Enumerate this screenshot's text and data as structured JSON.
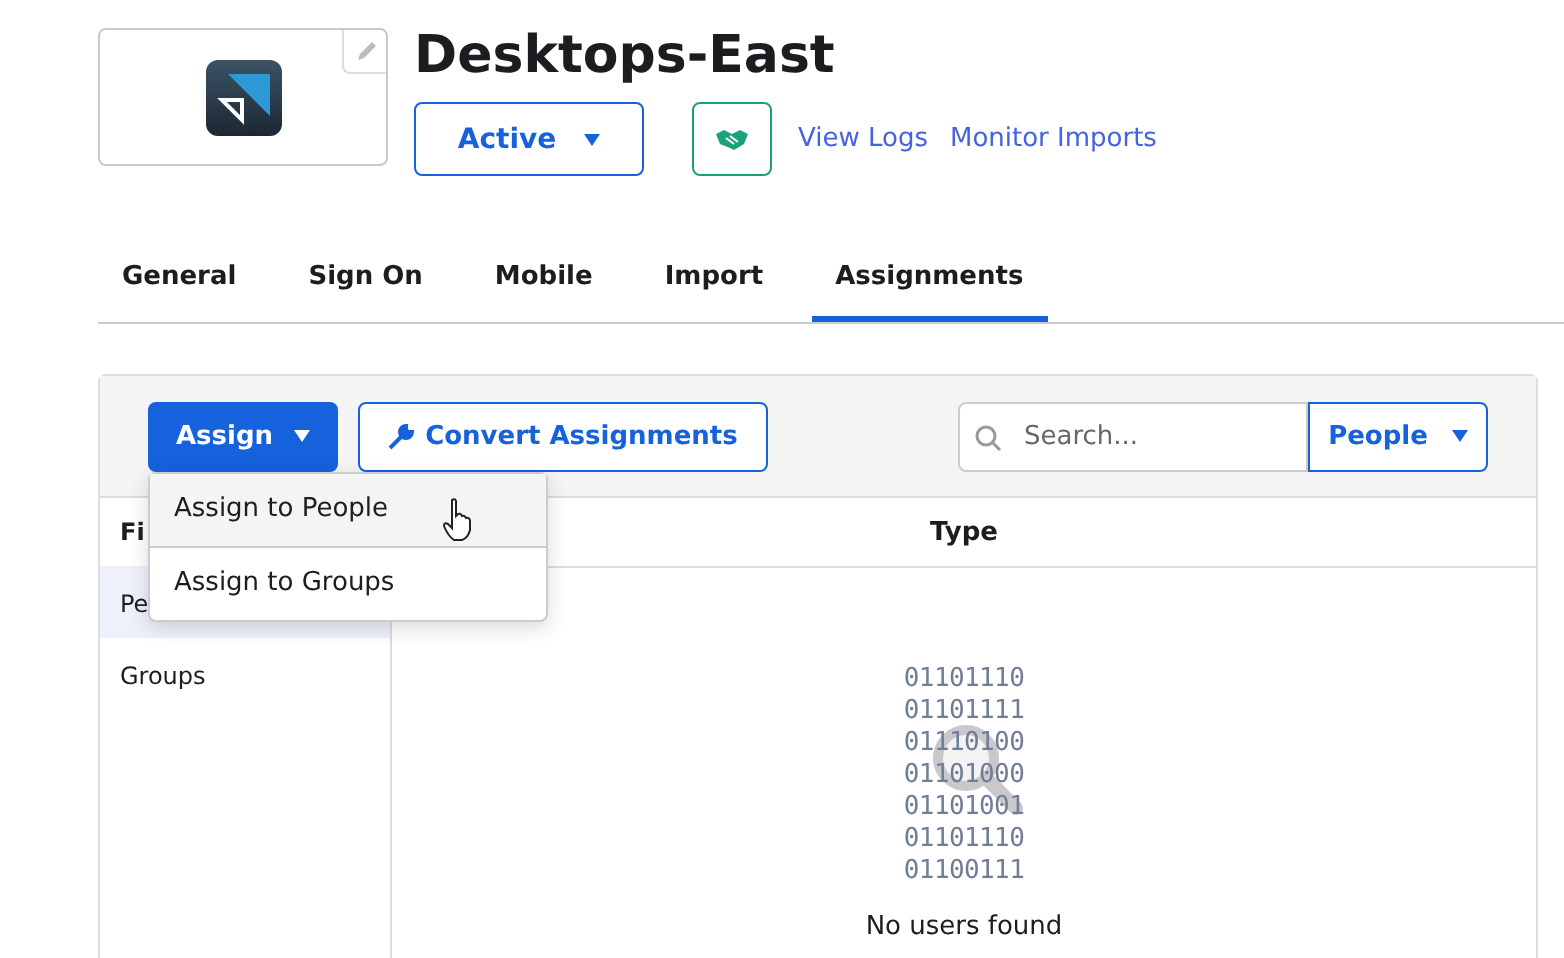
{
  "app": {
    "title": "Desktops-East",
    "status": "Active",
    "links": [
      "View Logs",
      "Monitor Imports"
    ]
  },
  "tabs": [
    {
      "label": "General",
      "selected": false
    },
    {
      "label": "Sign On",
      "selected": false
    },
    {
      "label": "Mobile",
      "selected": false
    },
    {
      "label": "Import",
      "selected": false
    },
    {
      "label": "Assignments",
      "selected": true
    }
  ],
  "toolbar": {
    "assign": "Assign",
    "convert": "Convert Assignments",
    "search": {
      "placeholder": "Search..."
    },
    "filter": "People"
  },
  "assign_menu": [
    "Assign to People",
    "Assign to Groups"
  ],
  "sidebar": {
    "heading": "Fi",
    "items": [
      {
        "label": "Pe",
        "selected": true
      },
      {
        "label": "Groups",
        "selected": false
      }
    ]
  },
  "table": {
    "columns": [
      "Type"
    ]
  },
  "empty_state": {
    "binary": [
      "01101110",
      "01101111",
      "01110100",
      "01101000",
      "01101001",
      "01101110",
      "01100111"
    ],
    "message": "No users found"
  }
}
